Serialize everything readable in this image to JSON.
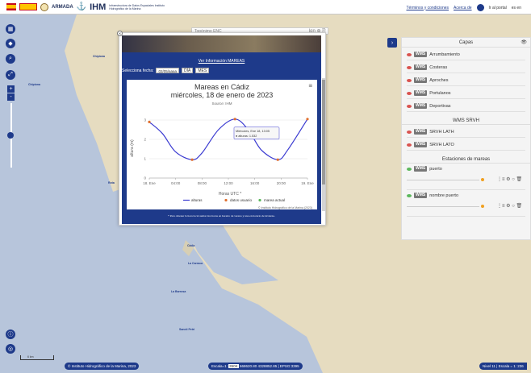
{
  "header": {
    "logo_gob": "GOBIERNO DE ESPAÑA",
    "logo_armada": "ARMADA",
    "logo_ihm": "IHM",
    "logo_ihm_sub": "Infraestructura de Datos Espaciales Instituto Hidrográfico de la Marina",
    "links": {
      "terms": "Términos y condiciones",
      "about": "Acerca de",
      "portal": "Ir al portal"
    },
    "language": "es en"
  },
  "search": {
    "placeholder": "Topónimo ENC",
    "extra": "Ign"
  },
  "controls": [
    "map-icon",
    "layers-icon",
    "search-icon",
    "fullscreen-icon",
    "+",
    "-"
  ],
  "popup": {
    "link_label": "Ver Información MAREAS",
    "date_label": "Selecciona fecha:",
    "date_value": "02/05/aaaa",
    "btn_day": "DÍA",
    "btn_month": "MES",
    "footnote": "* Para obtener la hora local sumar dos horas en horario de verano y una en horario de invierno."
  },
  "chart_data": {
    "type": "line",
    "title": "Mareas en Cádiz",
    "subtitle": "miércoles, 18 de enero de 2023",
    "source": "Source: IHM",
    "ylabel": "altura (m)",
    "xlabel": "Horas UTC *",
    "ylim": [
      0,
      3.5
    ],
    "yticks": [
      0,
      1,
      2,
      3
    ],
    "xticks": [
      "18. Ene",
      "04:00",
      "08:00",
      "12:00",
      "16:00",
      "20:00",
      "19. Ene"
    ],
    "series": [
      {
        "name": "alturas",
        "color": "#3b3bd1",
        "x_hours": [
          0,
          2,
          4,
          6.5,
          8,
          10.5,
          13,
          15,
          17,
          19.5,
          21,
          24
        ],
        "values": [
          2.9,
          2.3,
          1.35,
          0.95,
          1.3,
          2.5,
          3.05,
          2.5,
          1.45,
          0.95,
          1.45,
          3.05
        ]
      },
      {
        "name": "datos usuario",
        "color": "#e07030",
        "x_hours": [
          0,
          6.5,
          13,
          19.5,
          24
        ],
        "values": [
          2.9,
          0.95,
          3.05,
          0.95,
          3.05
        ]
      },
      {
        "name": "marea actual",
        "color": "#5cb85c",
        "x_hours": [],
        "values": []
      }
    ],
    "tooltip": {
      "line1": "Miércoles, Ene 18, 13:05",
      "line2": "● alturas: 1.532"
    },
    "credits": "© Instituto Hidrográfico de la Marina (2023)"
  },
  "panel": {
    "title": "Capas",
    "layers": [
      {
        "badge": "WMS",
        "label": "Arrumbamiento"
      },
      {
        "badge": "WMS",
        "label": "Costeras"
      },
      {
        "badge": "WMS",
        "label": "Aproches"
      },
      {
        "badge": "WMS",
        "label": "Portulanos"
      },
      {
        "badge": "WMS",
        "label": "Deportivas"
      }
    ],
    "srvh_title": "WMS SRVH",
    "srvh": [
      {
        "badge": "WMS",
        "label": "SRVH LATH"
      },
      {
        "badge": "WMS",
        "label": "SRVH LATO"
      }
    ],
    "stations_title": "Estaciones de mareas",
    "stations": [
      {
        "badge": "WMS",
        "label": "puerto"
      },
      {
        "badge": "WMS",
        "label": "nombre puerto"
      }
    ]
  },
  "places": [
    "Chipiona",
    "Rota",
    "Cádiz",
    "La Carraca",
    "Sancti Petri",
    "La Barrosa"
  ],
  "bottom": {
    "credit": "© Instituto Hidrográfico de la Marina, 2023",
    "scale_label": "Escala=1:",
    "scale_value": "350K",
    "coords": "668620.80  4328852.85 | EPSG:3395",
    "level": "Nivel 11 | Escala = 1: 236",
    "km": "6 km"
  }
}
